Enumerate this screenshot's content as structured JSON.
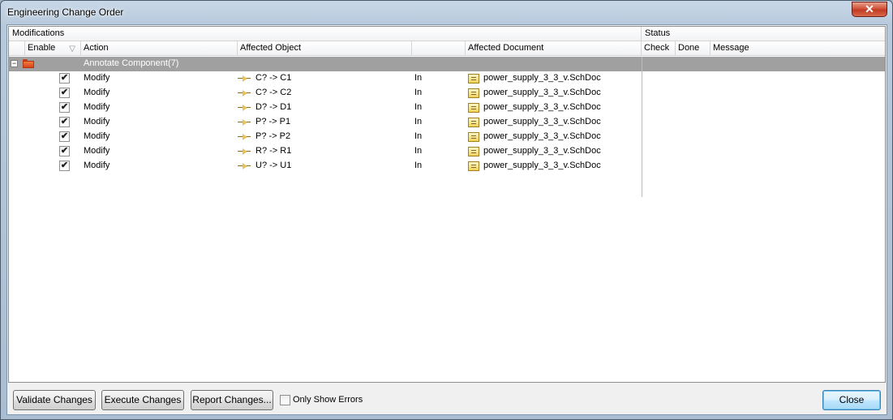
{
  "window": {
    "title": "Engineering Change Order",
    "close_glyph": "✕"
  },
  "grid": {
    "bands": {
      "modifications": "Modifications",
      "status": "Status"
    },
    "columns": {
      "enable": "Enable",
      "action": "Action",
      "affected_object": "Affected Object",
      "blank": "",
      "affected_document": "Affected Document",
      "check": "Check",
      "done": "Done",
      "message": "Message"
    },
    "filter_icon": "▽",
    "group": {
      "label": "Annotate Component(7)",
      "expander": "−",
      "icon": "folder-icon"
    },
    "rows": [
      {
        "enabled": true,
        "check_glyph": "✔",
        "action": "Modify",
        "object": "C? -> C1",
        "dir": "In",
        "document": "power_supply_3_3_v.SchDoc"
      },
      {
        "enabled": true,
        "check_glyph": "✔",
        "action": "Modify",
        "object": "C? -> C2",
        "dir": "In",
        "document": "power_supply_3_3_v.SchDoc"
      },
      {
        "enabled": true,
        "check_glyph": "✔",
        "action": "Modify",
        "object": "D? -> D1",
        "dir": "In",
        "document": "power_supply_3_3_v.SchDoc"
      },
      {
        "enabled": true,
        "check_glyph": "✔",
        "action": "Modify",
        "object": "P? -> P1",
        "dir": "In",
        "document": "power_supply_3_3_v.SchDoc"
      },
      {
        "enabled": true,
        "check_glyph": "✔",
        "action": "Modify",
        "object": "P? -> P2",
        "dir": "In",
        "document": "power_supply_3_3_v.SchDoc"
      },
      {
        "enabled": true,
        "check_glyph": "✔",
        "action": "Modify",
        "object": "R? -> R1",
        "dir": "In",
        "document": "power_supply_3_3_v.SchDoc"
      },
      {
        "enabled": true,
        "check_glyph": "✔",
        "action": "Modify",
        "object": "U? -> U1",
        "dir": "In",
        "document": "power_supply_3_3_v.SchDoc"
      }
    ]
  },
  "footer": {
    "validate": "Validate Changes",
    "execute": "Execute Changes",
    "report": "Report Changes...",
    "only_show_errors": "Only Show Errors",
    "only_show_errors_checked": false,
    "close": "Close"
  }
}
